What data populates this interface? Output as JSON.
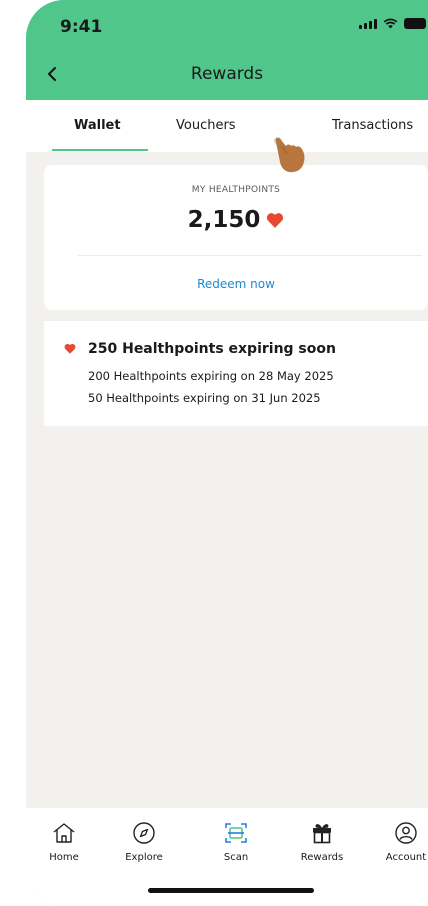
{
  "status_bar": {
    "time": "9:41"
  },
  "header": {
    "title": "Rewards"
  },
  "tabs": [
    {
      "label": "Wallet",
      "active": true
    },
    {
      "label": "Vouchers",
      "active": false
    },
    {
      "label": "Transactions",
      "active": false
    }
  ],
  "wallet_card": {
    "label": "MY HEALTHPOINTS",
    "points": "2,150",
    "redeem_label": "Redeem now"
  },
  "expiry": {
    "title": "250 Healthpoints expiring soon",
    "lines": [
      "200 Healthpoints expiring on 28 May 2025",
      "50 Healthpoints expiring on 31 Jun 2025"
    ]
  },
  "bottom_nav": [
    {
      "label": "Home",
      "icon": "home-icon"
    },
    {
      "label": "Explore",
      "icon": "compass-icon"
    },
    {
      "label": "Scan",
      "icon": "scan-icon"
    },
    {
      "label": "Rewards",
      "icon": "gift-icon",
      "active": true
    },
    {
      "label": "Account",
      "icon": "user-icon"
    }
  ],
  "colors": {
    "brand_green": "#50c68b",
    "heart_red": "#e34a2f",
    "link_blue": "#1e8ad6",
    "background": "#f2f1ee"
  }
}
